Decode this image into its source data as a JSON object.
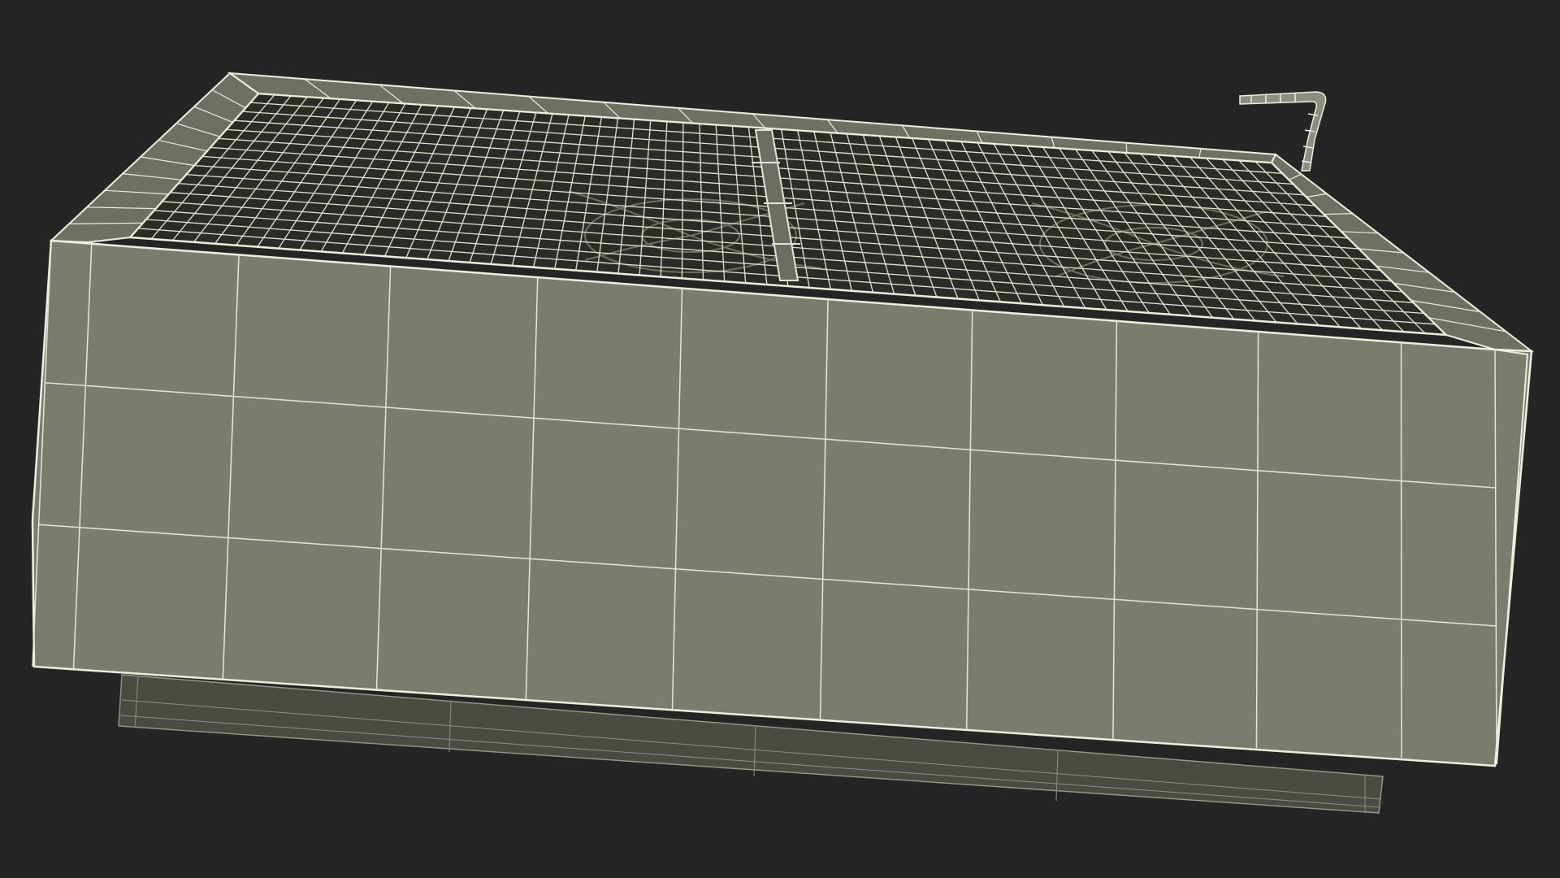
{
  "scene": {
    "subject": "wireframe-render-3d-model",
    "background_color": "#252525",
    "mesh_fill_color": "#7b7b6f",
    "top_fill_color": "#3a3b36",
    "grille_shadow_color": "#1e1f1c",
    "wire_color": "#eeeedd",
    "skirt_fill_color": "#4b4b44",
    "skirt_wire_color": "#8f8f80",
    "icons": [
      "wire-mesh-grille",
      "fan-blade",
      "pipe-fitting"
    ]
  }
}
